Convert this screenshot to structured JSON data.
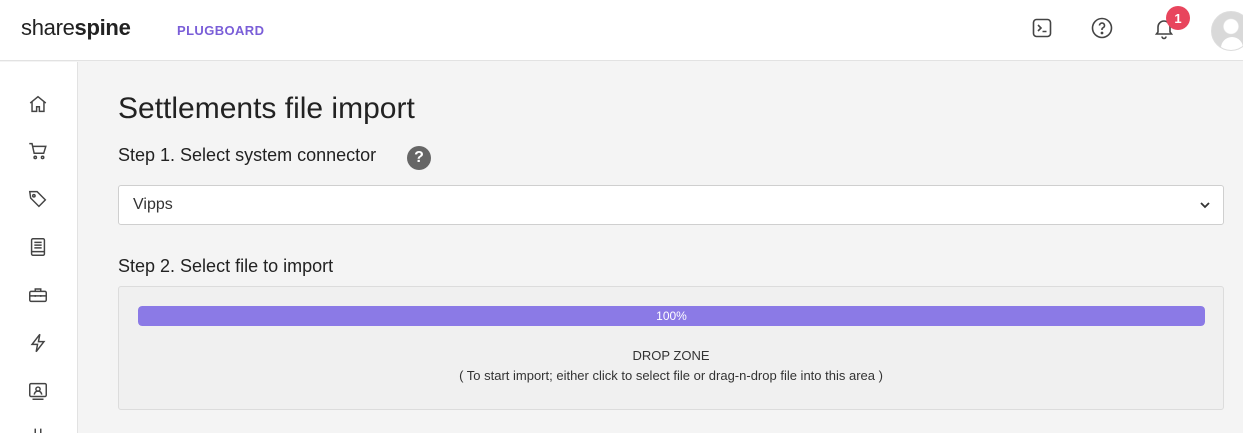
{
  "header": {
    "brand_light": "share",
    "brand_bold": "spine",
    "product": "PLUGBOARD",
    "notification_count": "1",
    "icons": [
      "terminal-icon",
      "help-circle-icon",
      "bell-icon",
      "avatar"
    ]
  },
  "sidebar": {
    "items": [
      {
        "icon": "home-icon"
      },
      {
        "icon": "cart-icon"
      },
      {
        "icon": "tag-icon"
      },
      {
        "icon": "book-icon"
      },
      {
        "icon": "toolbox-icon"
      },
      {
        "icon": "lightning-icon"
      },
      {
        "icon": "contact-card-icon"
      },
      {
        "icon": "more-icon"
      }
    ]
  },
  "main": {
    "title": "Settlements file import",
    "step1_label": "Step 1. Select system connector",
    "help_symbol": "?",
    "connector_selected": "Vipps",
    "step2_label": "Step 2. Select file to import",
    "progress_value": 100,
    "progress_label": "100%",
    "dropzone_title": "DROP ZONE",
    "dropzone_hint": "( To start import; either click to select file or drag-n-drop file into this area )"
  },
  "colors": {
    "accent": "#7a5ed8",
    "progress": "#8b7ae6",
    "badge": "#e8455d"
  }
}
